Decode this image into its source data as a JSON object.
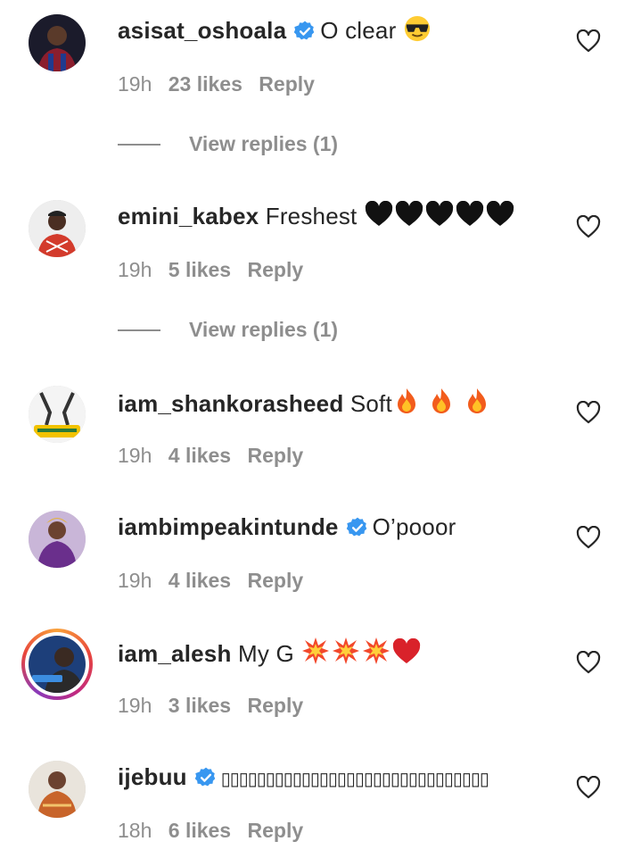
{
  "comments": [
    {
      "username": "asisat_oshoala",
      "verified": true,
      "text": "O clear ",
      "time": "19h",
      "likes": "23 likes",
      "reply": "Reply",
      "view_replies": "View replies (1)",
      "avatar_icon": "avatar-photo",
      "emoji": [
        "sunglasses-emoji"
      ]
    },
    {
      "username": "emini_kabex",
      "verified": false,
      "text": "Freshest ",
      "time": "19h",
      "likes": "5 likes",
      "reply": "Reply",
      "view_replies": "View replies (1)",
      "avatar_icon": "avatar-photo",
      "emoji": [
        "black-heart-emoji",
        "black-heart-emoji",
        "black-heart-emoji",
        "black-heart-emoji",
        "black-heart-emoji"
      ]
    },
    {
      "username": "iam_shankorasheed",
      "verified": false,
      "text": "Soft",
      "time": "19h",
      "likes": "4 likes",
      "reply": "Reply",
      "avatar_icon": "avatar-photo",
      "emoji": [
        "fire-emoji",
        "fire-emoji",
        "fire-emoji"
      ]
    },
    {
      "username": "iambimpeakintunde",
      "verified": true,
      "text": "O’pooor",
      "time": "19h",
      "likes": "4 likes",
      "reply": "Reply",
      "avatar_icon": "avatar-photo",
      "emoji": []
    },
    {
      "username": "iam_alesh",
      "verified": false,
      "text": "My G ",
      "time": "19h",
      "likes": "3 likes",
      "reply": "Reply",
      "avatar_icon": "avatar-photo-story-ring",
      "emoji": [
        "collision-emoji",
        "collision-emoji",
        "collision-emoji",
        "red-heart-emoji"
      ]
    },
    {
      "username": "ijebuu",
      "verified": true,
      "text": "▯▯▯▯▯▯▯▯▯▯▯▯▯▯▯▯▯▯▯▯▯▯▯▯▯▯▯▯▯▯",
      "time": "18h",
      "likes": "6 likes",
      "reply": "Reply",
      "avatar_icon": "avatar-photo",
      "emoji": []
    }
  ],
  "colors": {
    "text": "#262626",
    "meta": "#8e8e8e",
    "verified": "#3897f0"
  }
}
